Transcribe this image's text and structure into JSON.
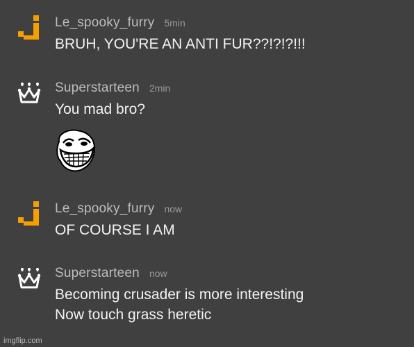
{
  "messages": [
    {
      "username": "Le_spooky_furry",
      "time": "5min",
      "avatar_icon": "orange-j-pixel-icon",
      "lines": [
        "BRUH, YOU'RE AN ANTI FUR??!?!?!!!"
      ]
    },
    {
      "username": "Superstarteen",
      "time": "2min",
      "avatar_icon": "crown-cross-icon",
      "lines": [
        "You mad bro?"
      ],
      "image": "trollface-icon"
    },
    {
      "username": "Le_spooky_furry",
      "time": "now",
      "avatar_icon": "orange-j-pixel-icon",
      "lines": [
        "OF COURSE I AM"
      ]
    },
    {
      "username": "Superstarteen",
      "time": "now",
      "avatar_icon": "crown-cross-icon",
      "lines": [
        "Becoming crusader is more interesting",
        "Now touch grass heretic"
      ]
    }
  ],
  "colors": {
    "background": "#404040",
    "username": "#bdbdbd",
    "timestamp": "#9a9a9a",
    "message_text": "#f2f2f2",
    "j_avatar": "#f5a000",
    "crown_avatar": "#ffffff"
  },
  "watermark": "imgflip.com"
}
